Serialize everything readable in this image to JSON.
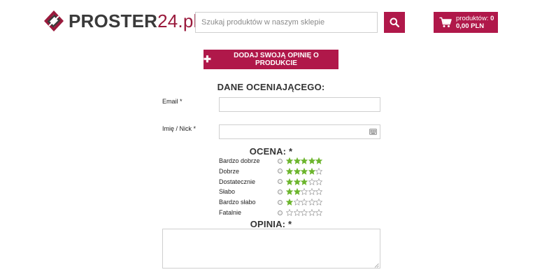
{
  "header": {
    "logo_text_main": "PROSTER",
    "logo_text_accent": "24.pl",
    "search": {
      "placeholder": "Szukaj produktów w naszym sklepie"
    },
    "search_icon": "search-icon",
    "cart": {
      "count_label": "produktów: ",
      "count": "0",
      "total": "0,00 PLN",
      "icon": "cart-icon"
    }
  },
  "add_review_button": {
    "plus": "✚",
    "label": "DODAJ SWOJĄ OPINIĘ O PRODUKCIE"
  },
  "form": {
    "reviewer_title": "DANE OCENIAJĄCEGO:",
    "email": {
      "label": "Email *",
      "value": ""
    },
    "nick": {
      "label": "Imię / Nick *",
      "value": ""
    },
    "rating_title": "OCENA: *",
    "ratings": [
      {
        "label": "Bardzo dobrze",
        "stars": 5
      },
      {
        "label": "Dobrze",
        "stars": 4
      },
      {
        "label": "Dostatecznie",
        "stars": 3
      },
      {
        "label": "Słabo",
        "stars": 2
      },
      {
        "label": "Bardzo słabo",
        "stars": 1
      },
      {
        "label": "Fatalnie",
        "stars": 0
      }
    ],
    "opinion_title": "OPINIA: *",
    "opinion_value": ""
  },
  "colors": {
    "accent": "#b0184a",
    "star_filled": "#6cb52d",
    "star_empty": "#9a9a9a"
  }
}
